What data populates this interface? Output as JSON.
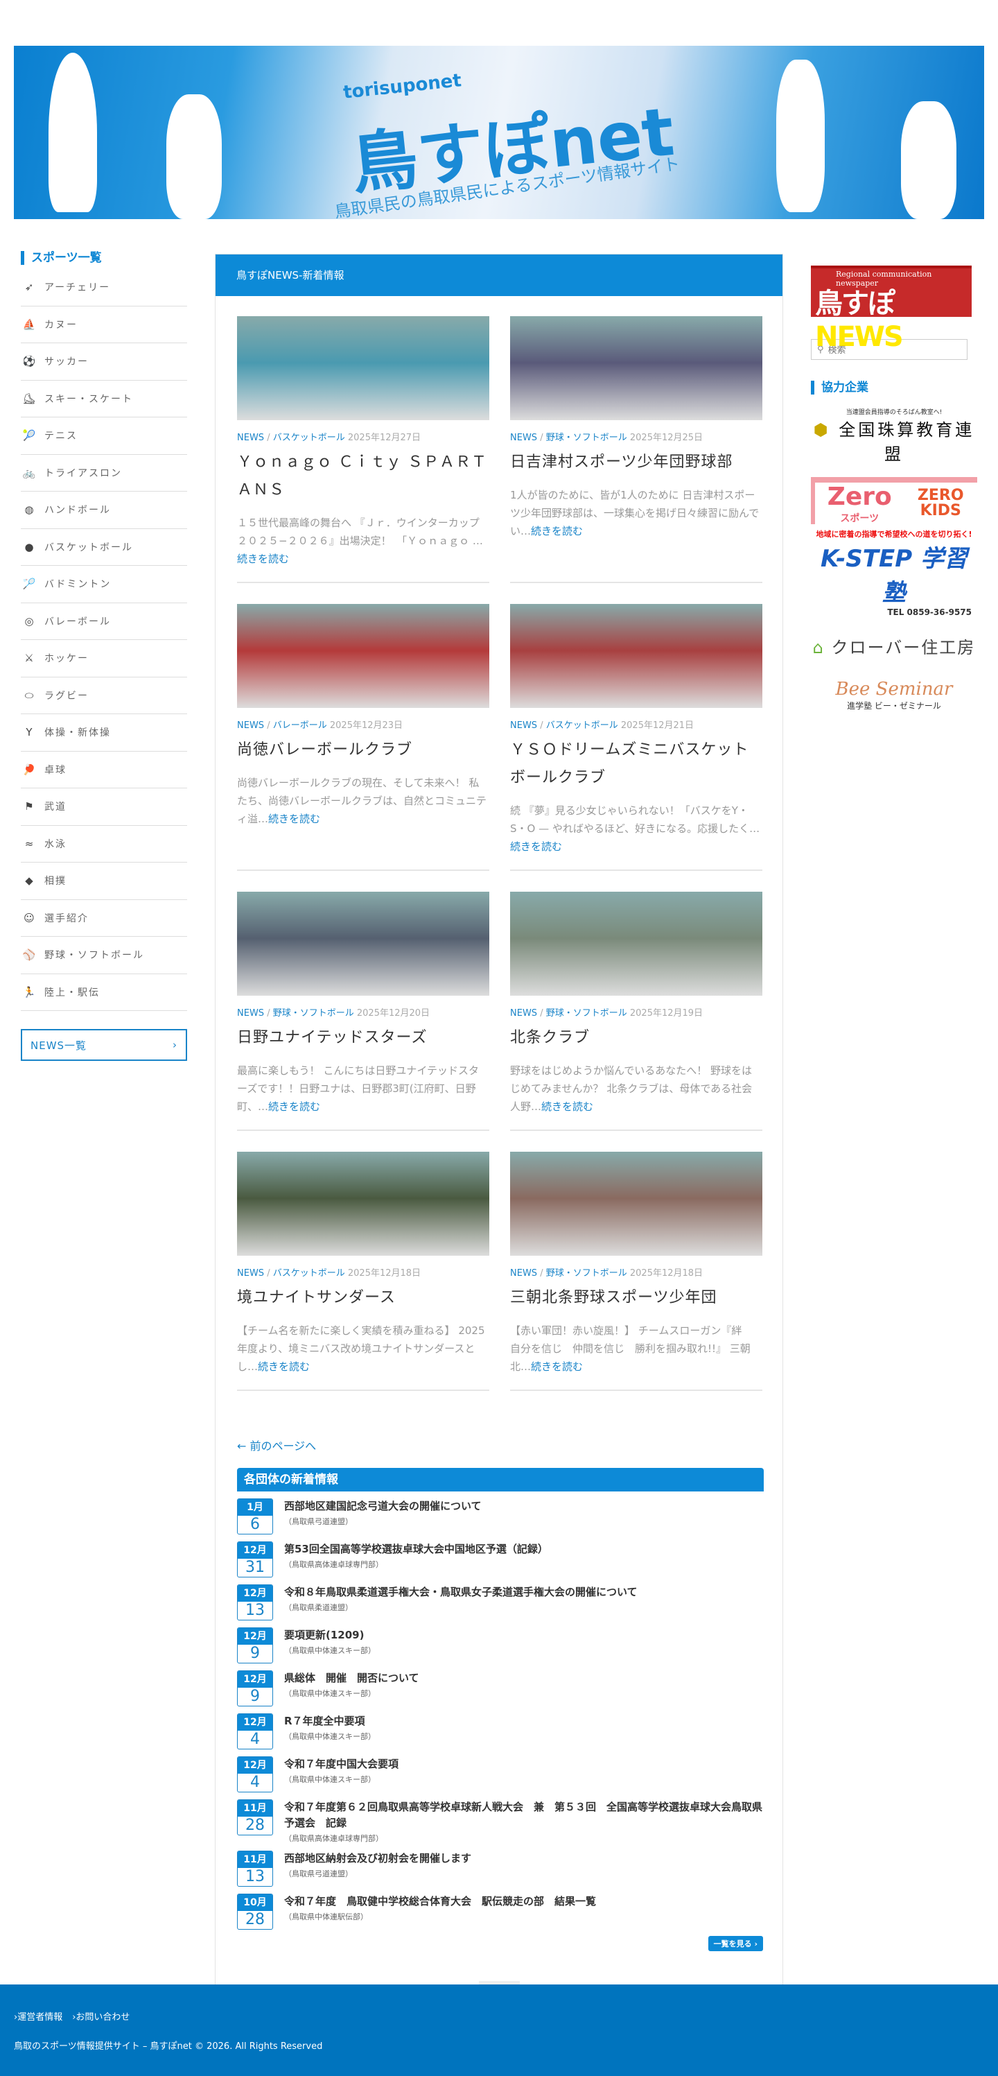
{
  "banner": {
    "subtitle": "torisuponet",
    "title": "鳥すぽnet",
    "tagline": "鳥取県民の鳥取県民によるスポーツ情報サイト"
  },
  "left_sidebar": {
    "heading": "スポーツ一覧",
    "items": [
      {
        "label": "アーチェリー",
        "icon": "➶"
      },
      {
        "label": "カヌー",
        "icon": "⛵"
      },
      {
        "label": "サッカー",
        "icon": "⚽"
      },
      {
        "label": "スキー・スケート",
        "icon": "⛸"
      },
      {
        "label": "テニス",
        "icon": "🎾"
      },
      {
        "label": "トライアスロン",
        "icon": "🚲"
      },
      {
        "label": "ハンドボール",
        "icon": "◍"
      },
      {
        "label": "バスケットボール",
        "icon": "●"
      },
      {
        "label": "バドミントン",
        "icon": "🏸"
      },
      {
        "label": "バレーボール",
        "icon": "◎"
      },
      {
        "label": "ホッケー",
        "icon": "⚔"
      },
      {
        "label": "ラグビー",
        "icon": "⬭"
      },
      {
        "label": "体操・新体操",
        "icon": "Y"
      },
      {
        "label": "卓球",
        "icon": "🏓"
      },
      {
        "label": "武道",
        "icon": "⚑"
      },
      {
        "label": "水泳",
        "icon": "≈"
      },
      {
        "label": "相撲",
        "icon": "◆"
      },
      {
        "label": "選手紹介",
        "icon": "☺"
      },
      {
        "label": "野球・ソフトボール",
        "icon": "⚾"
      },
      {
        "label": "陸上・駅伝",
        "icon": "🏃"
      }
    ],
    "news_button": "NEWS一覧",
    "news_arrow": "›"
  },
  "main": {
    "heading": "鳥すぽNEWS-新着情報",
    "news_label": "NEWS",
    "sep": "/",
    "read_more": "続きを読む",
    "posts": [
      {
        "category": "バスケットボール",
        "date": "2025年12月27日",
        "title": "Ｙｏｎａｇｏ Ｃｉｔｙ ＳＰＡＲＴＡＮＳ",
        "excerpt": "１５世代最高峰の舞台へ 『Ｊｒ．ウインターカップ２０２５−２０２６』出場決定！　「Ｙｏｎａｇｏ …",
        "color": "#4a9ab0"
      },
      {
        "category": "野球・ソフトボール",
        "date": "2025年12月25日",
        "title": "日吉津村スポーツ少年団野球部",
        "excerpt": "1人が皆のために、皆が1人のために 日吉津村スポーツ少年団野球部は、一球集心を掲げ日々練習に励んでい…",
        "color": "#5a5a7a"
      },
      {
        "category": "バレーボール",
        "date": "2025年12月23日",
        "title": "尚徳バレーボールクラブ",
        "excerpt": "尚徳バレーボールクラブの現在、そして未来へ！ 私たち、尚徳バレーボールクラブは、自然とコミュニティ溢…",
        "color": "#b43a3a"
      },
      {
        "category": "バスケットボール",
        "date": "2025年12月21日",
        "title": "ＹＳＯドリームズミニバスケットボールクラブ",
        "excerpt": "続 『夢』見る少女じゃいられない！「バスケをY・S・O — やればやるほど、好きになる。応援したく…",
        "color": "#a84040"
      },
      {
        "category": "野球・ソフトボール",
        "date": "2025年12月20日",
        "title": "日野ユナイテッドスターズ",
        "excerpt": "最高に楽しもう！ こんにちは日野ユナイテッドスターズです！！日野ユナは、日野郡3町(江府町、日野町、…",
        "color": "#556070"
      },
      {
        "category": "野球・ソフトボール",
        "date": "2025年12月19日",
        "title": "北条クラブ",
        "excerpt": "野球をはじめようか悩んでいるあなたへ！ 野球をはじめてみませんか？ 北条クラブは、母体である社会人野…",
        "color": "#7a8a7a"
      },
      {
        "category": "バスケットボール",
        "date": "2025年12月18日",
        "title": "境ユナイトサンダース",
        "excerpt": "【チーム名を新たに楽しく実績を積み重ねる】 2025年度より、境ミニバス改め境ユナイトサンダースとし…",
        "color": "#4a5a40"
      },
      {
        "category": "野球・ソフトボール",
        "date": "2025年12月18日",
        "title": "三朝北条野球スポーツ少年団",
        "excerpt": "【赤い軍団！赤い旋風！】 チームスローガン『絆　自分を信じ　仲間を信じ　勝利を掴み取れ!!』 三朝北…",
        "color": "#8a6a60"
      }
    ],
    "prev_page": "← 前のページへ",
    "org_news": {
      "heading": "各団体の新着情報",
      "items": [
        {
          "month": "1月",
          "day": "6",
          "title": "西部地区建国記念弓道大会の開催について",
          "org": "（鳥取県弓道連盟）"
        },
        {
          "month": "12月",
          "day": "31",
          "title": "第53回全国高等学校選抜卓球大会中国地区予選（記録）",
          "org": "（鳥取県高体連卓球専門部）"
        },
        {
          "month": "12月",
          "day": "13",
          "title": "令和８年鳥取県柔道選手権大会・鳥取県女子柔道選手権大会の開催について",
          "org": "（鳥取県柔道連盟）"
        },
        {
          "month": "12月",
          "day": "9",
          "title": "要項更新(1209)",
          "org": "（鳥取県中体連スキー部）"
        },
        {
          "month": "12月",
          "day": "9",
          "title": "県総体　開催　開否について",
          "org": "（鳥取県中体連スキー部）"
        },
        {
          "month": "12月",
          "day": "4",
          "title": "R７年度全中要項",
          "org": "（鳥取県中体連スキー部）"
        },
        {
          "month": "12月",
          "day": "4",
          "title": "令和７年度中国大会要項",
          "org": "（鳥取県中体連スキー部）"
        },
        {
          "month": "11月",
          "day": "28",
          "title": "令和７年度第６２回鳥取県高等学校卓球新人戦大会　兼　第５３回　全国高等学校選抜卓球大会鳥取県予選会　記録",
          "org": "（鳥取県高体連卓球専門部）"
        },
        {
          "month": "11月",
          "day": "13",
          "title": "西部地区納射会及び初射会を開催します",
          "org": "（鳥取県弓道連盟）"
        },
        {
          "month": "10月",
          "day": "28",
          "title": "令和７年度　鳥取健中学校総合体育大会　駅伝競走の部　結果一覧",
          "org": "（鳥取県中体連駅伝部）"
        }
      ],
      "more": "一覧を見る ›"
    }
  },
  "right_sidebar": {
    "ad": {
      "tagline": "Regional communication newspaper",
      "title_a": "鳥すぽ",
      "title_b": "NEWS"
    },
    "search_placeholder": "検索",
    "partners_heading": "協力企業",
    "partners": {
      "p1_sub": "当連盟会員指導のそろばん教室へ!",
      "p1": "全国珠算教育連盟",
      "p2a": "Zero",
      "p2a_sub": "スポーツ",
      "p2b": "ZERO KIDS",
      "p3_tag": "地域に密着の指導で希望校への道を切り拓く!",
      "p3": "K-STEP 学習塾",
      "p3_tel": "TEL 0859-36-9575",
      "p4": "クローバー住工房",
      "p5": "Bee Seminar",
      "p5_sub": "進学塾 ビー・ゼミナール"
    }
  },
  "footer": {
    "links": [
      "›運営者情報",
      "›お問い合わせ"
    ],
    "copyright": "鳥取のスポーツ情報提供サイト – 鳥すぽnet © 2026. All Rights Reserved",
    "to_top": "^"
  }
}
